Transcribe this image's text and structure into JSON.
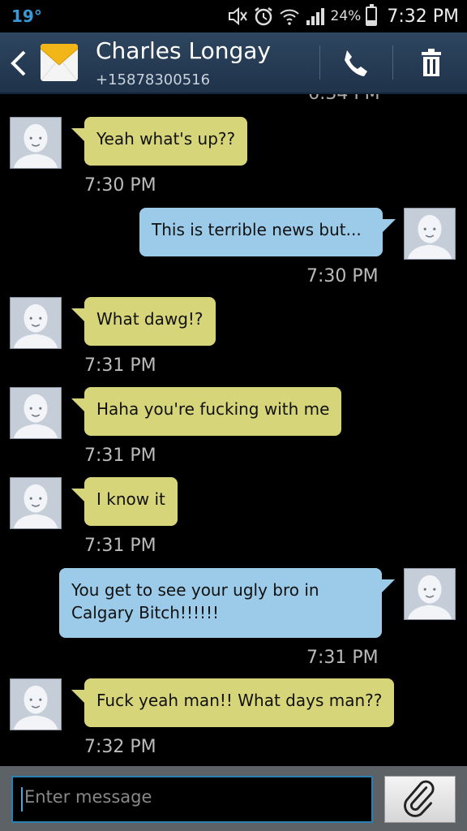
{
  "status": {
    "temperature": "19°",
    "battery_percent": "24%",
    "battery_level": 0.24,
    "clock": "7:32 PM",
    "icons": [
      "mute-icon",
      "alarm-icon",
      "wifi-icon",
      "signal-icon",
      "battery-icon"
    ]
  },
  "header": {
    "contact_name": "Charles Longay",
    "contact_number": "+15878300516",
    "icons": [
      "back-icon",
      "envelope-icon",
      "phone-icon",
      "trash-icon"
    ]
  },
  "conversation": {
    "clipped_time": "6:34 PM",
    "messages": [
      {
        "direction": "in",
        "text": "Yeah what's up??",
        "time": "7:30 PM"
      },
      {
        "direction": "out",
        "text": "This is terrible news but...",
        "time": "7:30 PM"
      },
      {
        "direction": "in",
        "text": "What dawg!?",
        "time": "7:31 PM"
      },
      {
        "direction": "in",
        "text": "Haha you're fucking with me",
        "time": "7:31 PM"
      },
      {
        "direction": "in",
        "text": "I know it",
        "time": "7:31 PM"
      },
      {
        "direction": "out",
        "text": "You get to see your ugly bro in Calgary Bitch!!!!!!",
        "time": "7:31 PM"
      },
      {
        "direction": "in",
        "text": "Fuck yeah man!! What days man??",
        "time": "7:32 PM"
      }
    ]
  },
  "composer": {
    "placeholder": "Enter message",
    "attach_icon": "paperclip-icon"
  },
  "colors": {
    "incoming_bubble": "#d7d57a",
    "outgoing_bubble": "#9ccbe9",
    "header_bg": "#2e4660"
  }
}
